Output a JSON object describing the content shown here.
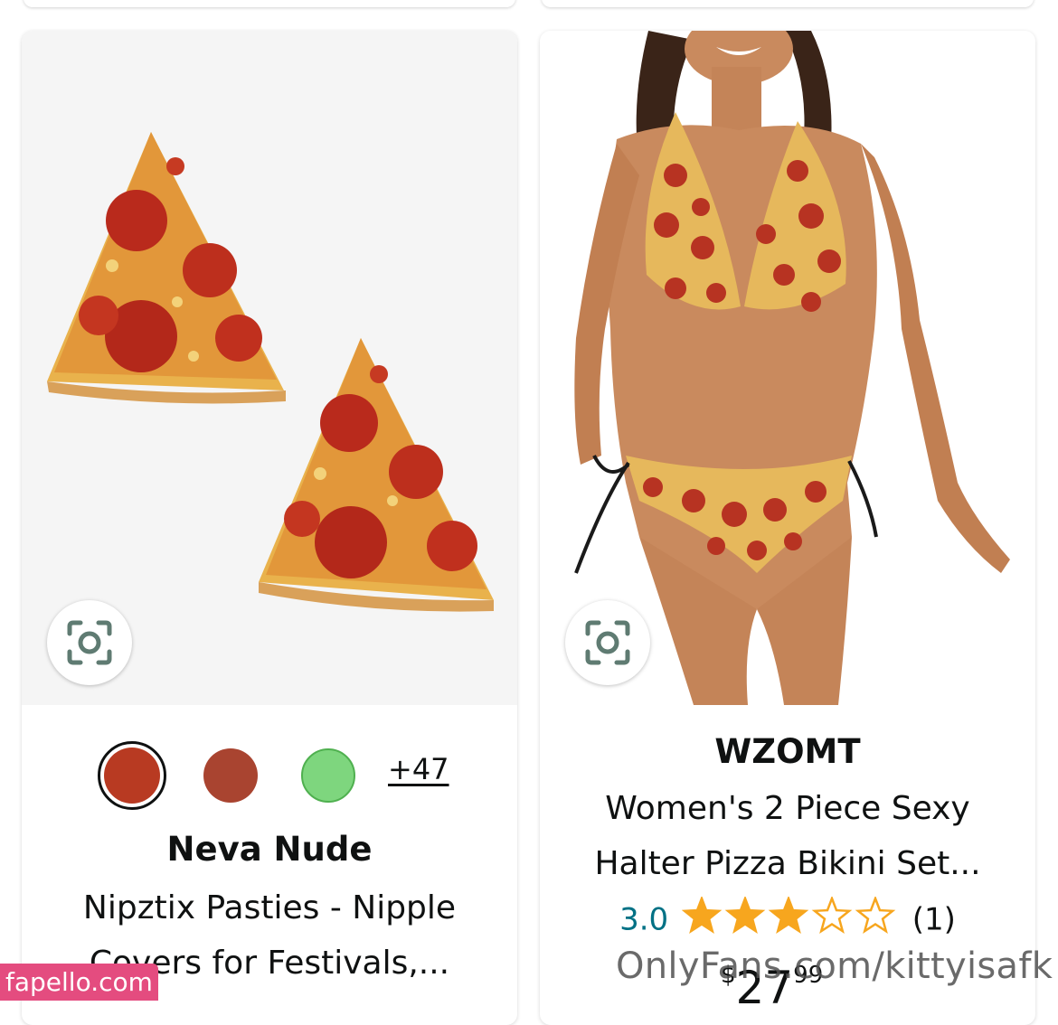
{
  "products": [
    {
      "colors": [
        "#b83a22",
        "#a94430",
        "#7ed67e"
      ],
      "more_colors": "+47",
      "brand": "Neva Nude",
      "title_line1": "Nipztix Pasties - Nipple",
      "title_line2": "Covers for Festivals,..."
    },
    {
      "brand": "WZOMT",
      "title_line1": "Women's 2 Piece Sexy",
      "title_line2": "Halter Pizza Bikini Set...",
      "rating": "3.0",
      "stars": 3.0,
      "review_count": "(1)",
      "price_symbol": "$",
      "price_whole": "27",
      "price_fraction": "99"
    }
  ],
  "icons": {
    "visual_search": "camera-lens-icon",
    "rating": "star-icon"
  },
  "watermarks": {
    "left": "fapello.com",
    "right": "OnlyFans.com/kittyisafk"
  },
  "colors": {
    "rating_link": "#007185",
    "star_fill": "#f7a61e",
    "watermark_badge": "#e44c7f"
  }
}
